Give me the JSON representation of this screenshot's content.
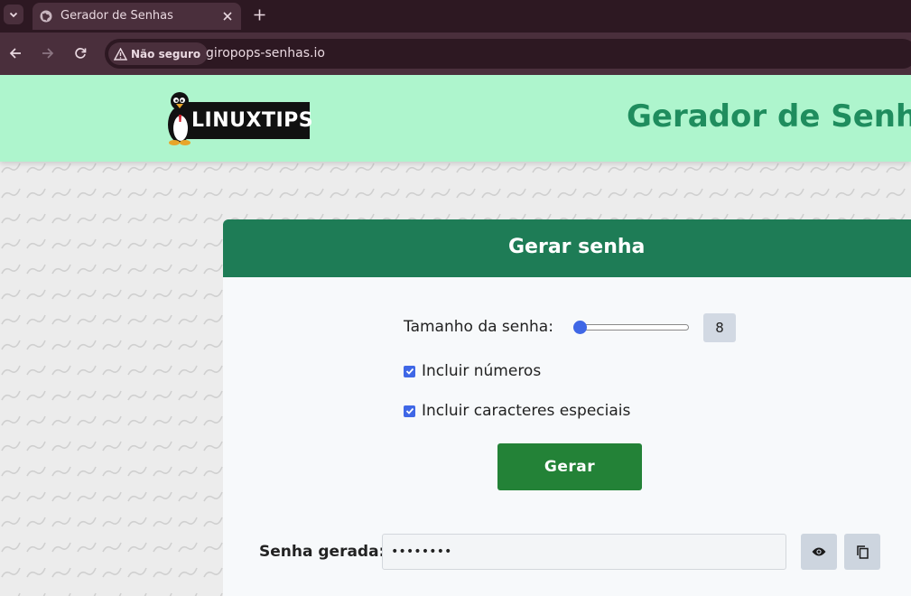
{
  "browser": {
    "tab": {
      "title": "Gerador de Senhas"
    },
    "security": {
      "label": "Não seguro"
    },
    "url": "giropops-senhas.io"
  },
  "header": {
    "logo_text": "LINUXTIPS",
    "title": "Gerador de Senhas"
  },
  "card": {
    "title": "Gerar senha",
    "length_label": "Tamanho da senha:",
    "length_value": "8",
    "length_slider_fraction": 0.0,
    "include_numbers": {
      "label": "Incluir números",
      "checked": true
    },
    "include_special": {
      "label": "Incluir caracteres especiais",
      "checked": true
    },
    "generate_label": "Gerar",
    "output_label": "Senha gerada:",
    "output_value": "••••••••"
  },
  "colors": {
    "header_bg": "#aef5cd",
    "title_green": "#1f8d5e",
    "card_header": "#1e7c56",
    "button_green": "#238237",
    "accent_blue": "#3f67e6"
  },
  "icons": [
    "chevron-down-icon",
    "globe-icon",
    "close-icon",
    "plus-icon",
    "back-arrow-icon",
    "forward-arrow-icon",
    "reload-icon",
    "warning-icon",
    "penguin-icon",
    "eye-icon",
    "copy-icon",
    "checkmark-icon"
  ]
}
